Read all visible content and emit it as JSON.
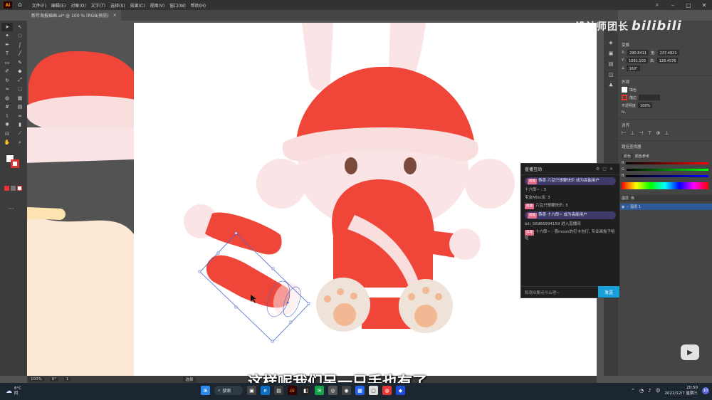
{
  "menubar": {
    "app_logo": "Ai",
    "items": [
      "文件(F)",
      "编辑(E)",
      "对象(O)",
      "文字(T)",
      "选择(S)",
      "效果(C)",
      "视图(V)",
      "窗口(W)",
      "帮助(H)"
    ]
  },
  "document": {
    "tab_title": "新年海报插画.ai* @ 100 % (RGB/预览)",
    "close_glyph": "×"
  },
  "statusbar": {
    "zoom": "100%",
    "rotation": "0°",
    "artboard": "1",
    "tool": "选择"
  },
  "properties": {
    "transform_title": "变换",
    "x": "290.8411",
    "y": "1091.103",
    "w": "237.4821",
    "h": "128.4576",
    "angle": "160°",
    "appearance_title": "外观",
    "fill_label": "填色",
    "stroke_label": "描边",
    "opacity_label": "不透明度",
    "opacity_value": "100%",
    "fx_label": "fx.",
    "align_title": "对齐",
    "pathfinder_title": "路径查找器",
    "color_tab": "颜色",
    "color_ref_tab": "颜色参考",
    "channel_r": "R",
    "channel_g": "G",
    "channel_b": "B",
    "layers_tab": "图层",
    "library_tab": "库",
    "layer_name": "图层 1"
  },
  "chat": {
    "title": "直播互动",
    "messages": [
      {
        "text": "恭喜 六豆只想要快乐 成为高能用户",
        "highlight": true,
        "badge": "高能"
      },
      {
        "text": "十六郎~ : 3",
        "highlight": false,
        "badge": ""
      },
      {
        "text": "宅女Miss派: 3",
        "highlight": false,
        "badge": ""
      },
      {
        "text": "六豆只想要快乐: 3",
        "highlight": false,
        "badge": "高能"
      },
      {
        "text": "恭喜 十六郎~ 成为高能用户",
        "highlight": true,
        "badge": "高能"
      },
      {
        "text": "bili_56966994159 进入直播间",
        "highlight": false,
        "badge": ""
      },
      {
        "text": "十六郎~ : 喜moon的打卡也行, 专业画兔子哈哈",
        "highlight": false,
        "badge": "高能"
      }
    ],
    "input_placeholder": "和观众聊点什么吧~",
    "send_label": "发送"
  },
  "watermark": {
    "text": "设计师团长",
    "brand": "bilibili"
  },
  "subtitle": "这样呢我们另一只手也有了",
  "taskbar": {
    "weather_temp": "8°C",
    "weather_desc": "阴",
    "search_label": "搜索",
    "time": "20:50",
    "date": "2022/12/7 星期三",
    "notification_count": "10"
  },
  "colors": {
    "santa_red": "#f0463a",
    "rabbit_pink": "#fbe4e6",
    "hat_trim": "#f8dedc",
    "paw_beige": "#efe2d8",
    "paw_pad": "#f1b893",
    "eye_brown": "#7b4a3a",
    "selection_blue": "#4a68c9",
    "artboard_bg": "#ffffff"
  }
}
